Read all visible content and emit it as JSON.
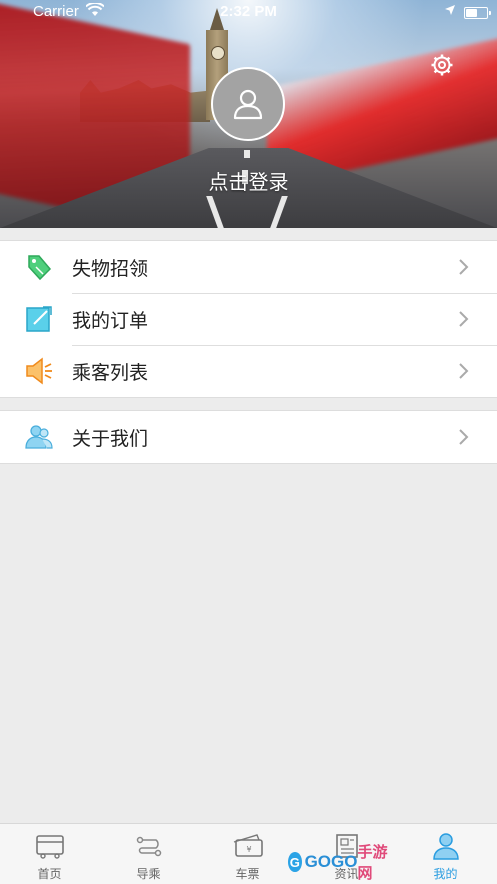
{
  "status_bar": {
    "carrier": "Carrier",
    "time": "2:32 PM",
    "battery_level": 0.6
  },
  "header": {
    "login_label": "点击登录"
  },
  "menu_group_1": [
    {
      "label": "失物招领",
      "icon": "tag-icon"
    },
    {
      "label": "我的订单",
      "icon": "order-edit-icon"
    },
    {
      "label": "乘客列表",
      "icon": "speaker-icon"
    }
  ],
  "menu_group_2": [
    {
      "label": "关于我们",
      "icon": "people-icon"
    }
  ],
  "tabs": [
    {
      "label": "首页",
      "icon": "bus-icon"
    },
    {
      "label": "导乘",
      "icon": "route-icon"
    },
    {
      "label": "车票",
      "icon": "ticket-icon"
    },
    {
      "label": "资讯",
      "icon": "news-icon"
    },
    {
      "label": "我的",
      "icon": "person-icon"
    }
  ],
  "active_tab": "我的",
  "watermark": {
    "text": "GOGO",
    "cn": "手游网"
  },
  "colors": {
    "accent": "#2a9de0",
    "tag_green": "#3bbf6a",
    "order_teal": "#36b6d8",
    "speaker_orange": "#f39a2b",
    "people_blue": "#6cc3ea"
  }
}
